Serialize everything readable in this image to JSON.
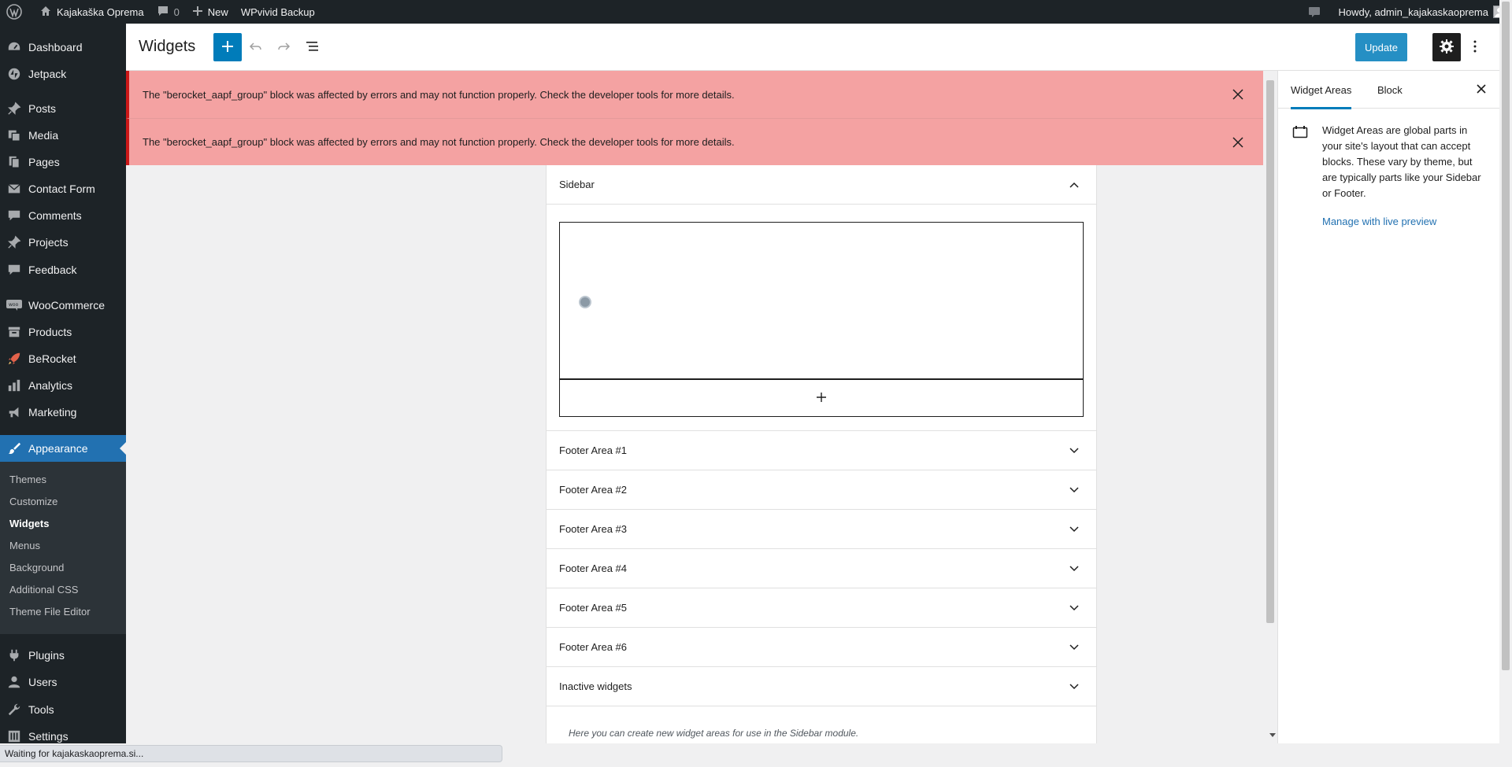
{
  "admin_bar": {
    "site_name": "Kajakaška Oprema",
    "comments_count": "0",
    "new_label": "New",
    "backup_label": "WPvivid Backup",
    "howdy": "Howdy, admin_kajakaskaoprema"
  },
  "menu": {
    "dashboard": "Dashboard",
    "jetpack": "Jetpack",
    "posts": "Posts",
    "media": "Media",
    "pages": "Pages",
    "contact_form": "Contact Form",
    "comments": "Comments",
    "projects": "Projects",
    "feedback": "Feedback",
    "woocommerce": "WooCommerce",
    "products": "Products",
    "berocket": "BeRocket",
    "analytics": "Analytics",
    "marketing": "Marketing",
    "appearance": "Appearance",
    "plugins": "Plugins",
    "users": "Users",
    "tools": "Tools",
    "settings": "Settings"
  },
  "submenu": {
    "themes": "Themes",
    "customize": "Customize",
    "widgets": "Widgets",
    "menus": "Menus",
    "background": "Background",
    "additional_css": "Additional CSS",
    "theme_file_editor": "Theme File Editor"
  },
  "header": {
    "title": "Widgets",
    "update_label": "Update"
  },
  "notices": [
    "The \"berocket_aapf_group\" block was affected by errors and may not function properly. Check the developer tools for more details.",
    "The \"berocket_aapf_group\" block was affected by errors and may not function properly. Check the developer tools for more details."
  ],
  "widget_areas": {
    "sidebar": "Sidebar",
    "footer1": "Footer Area #1",
    "footer2": "Footer Area #2",
    "footer3": "Footer Area #3",
    "footer4": "Footer Area #4",
    "footer5": "Footer Area #5",
    "footer6": "Footer Area #6",
    "inactive": "Inactive widgets",
    "inactive_desc": "Here you can create new widget areas for use in the Sidebar module."
  },
  "inspector": {
    "tab_widget_areas": "Widget Areas",
    "tab_block": "Block",
    "description": "Widget Areas are global parts in your site's layout that can accept blocks. These vary by theme, but are typically parts like your Sidebar or Footer.",
    "link": "Manage with live preview"
  },
  "status": {
    "text": "Waiting for kajakaskaoprema.si..."
  },
  "colors": {
    "admin_dark": "#1d2327",
    "accent": "#2271b1",
    "button_blue": "#007cba",
    "notice_bg": "#f4a2a2",
    "notice_border": "#cc1818"
  }
}
